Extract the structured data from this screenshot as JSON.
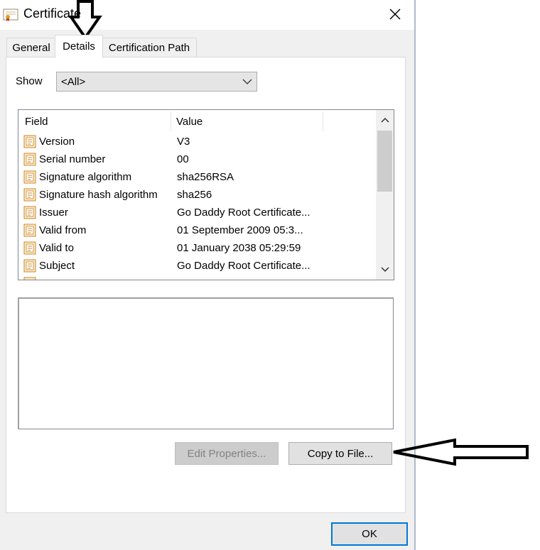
{
  "window": {
    "title": "Certificate",
    "close_icon": "close-icon",
    "icon": "certificate-icon"
  },
  "tabs": [
    {
      "label": "General",
      "active": false
    },
    {
      "label": "Details",
      "active": true
    },
    {
      "label": "Certification Path",
      "active": false
    }
  ],
  "show": {
    "label": "Show",
    "selected": "<All>"
  },
  "list": {
    "columns": [
      "Field",
      "Value"
    ],
    "rows": [
      {
        "field": "Version",
        "value": "V3"
      },
      {
        "field": "Serial number",
        "value": "00"
      },
      {
        "field": "Signature algorithm",
        "value": "sha256RSA"
      },
      {
        "field": "Signature hash algorithm",
        "value": "sha256"
      },
      {
        "field": "Issuer",
        "value": "Go Daddy Root Certificate..."
      },
      {
        "field": "Valid from",
        "value": "01 September 2009 05:3..."
      },
      {
        "field": "Valid to",
        "value": "01 January 2038 05:29:59"
      },
      {
        "field": "Subject",
        "value": "Go Daddy Root Certificate..."
      }
    ]
  },
  "buttons": {
    "edit_properties": "Edit Properties...",
    "copy_to_file": "Copy to File...",
    "ok": "OK"
  },
  "colors": {
    "accent": "#0078d7",
    "window_bg": "#f0f0f0"
  }
}
